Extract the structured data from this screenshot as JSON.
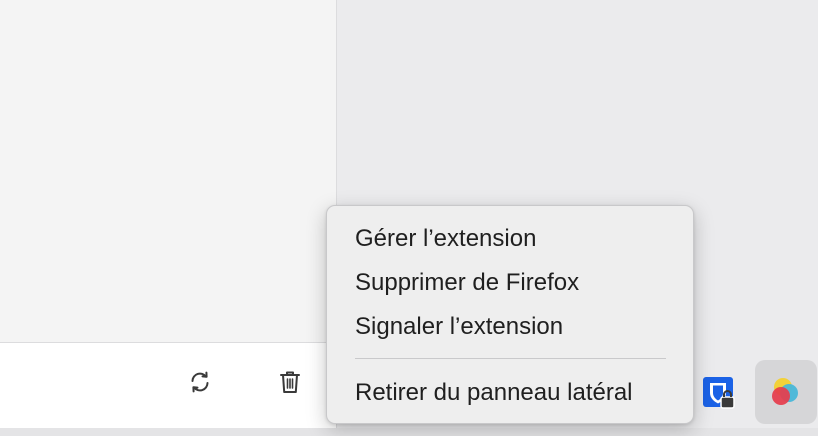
{
  "context_menu": {
    "items": [
      "Gérer l’extension",
      "Supprimer de Firefox",
      "Signaler l’extension"
    ],
    "secondary_item": "Retirer du panneau latéral"
  },
  "toolbar": {
    "icons": [
      "refresh-icon",
      "trash-icon"
    ]
  },
  "sidebar_extensions": [
    {
      "icon": "shield-lock-extension-icon",
      "color": "#1b62e6"
    },
    {
      "icon": "color-circles-extension-icon",
      "selected": true
    }
  ],
  "colors": {
    "menu_background": "#eeeeee",
    "panel_background": "#f4f4f4",
    "window_background": "#ebebed",
    "accent_blue": "#1b62e6"
  }
}
